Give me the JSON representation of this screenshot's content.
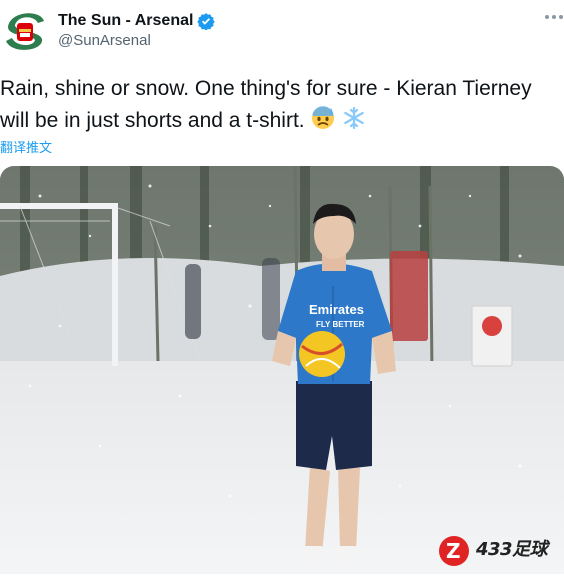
{
  "account": {
    "display_name": "The Sun - Arsenal",
    "handle": "@SunArsenal",
    "verified": true
  },
  "tweet": {
    "text": "Rain, shine or snow. One thing's for sure - Kieran Tierney will be in just shorts and a t-shirt.",
    "emojis": [
      "anxious-sweat-face-icon",
      "snowflake-icon"
    ]
  },
  "translate_label": "翻译推文",
  "photo": {
    "shirt_sponsor_line1": "Emirates",
    "shirt_sponsor_line2": "FLY BETTER"
  },
  "watermark": {
    "brand": "433足球",
    "letter": "Z"
  },
  "colors": {
    "link_blue": "#1d9bf0",
    "verified_blue": "#1d9bf0",
    "arsenal_red": "#db0007",
    "handle_gray": "#536471"
  }
}
